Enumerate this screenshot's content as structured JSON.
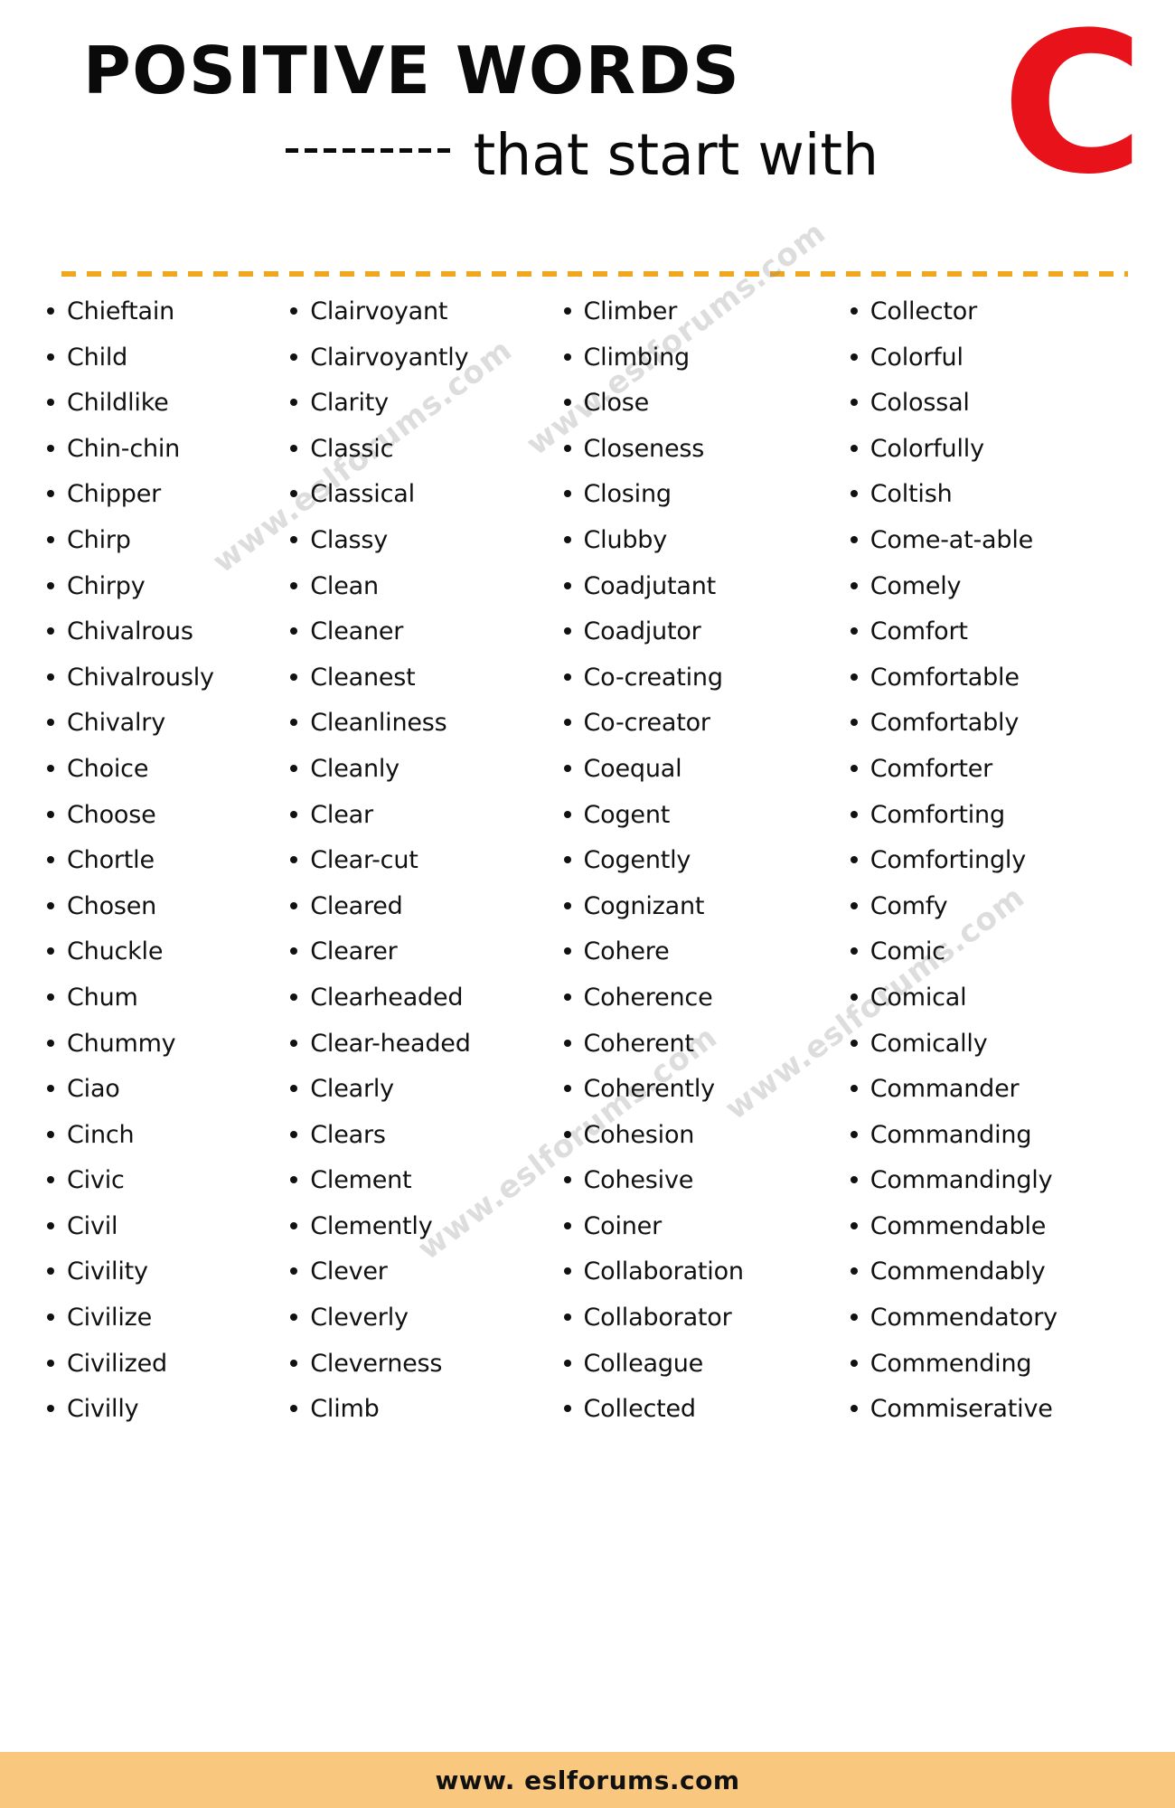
{
  "header": {
    "title_main": "POSITIVE WORDS",
    "title_sub": "that start with",
    "big_letter": "C",
    "accent_color": "#e8121a",
    "divider_color": "#efa620"
  },
  "watermark": {
    "text": "www.eslforums.com"
  },
  "footer": {
    "site": "www. eslforums.com",
    "background_color": "#f9c87e"
  },
  "columns": [
    {
      "id": "column-1",
      "words": [
        "Chieftain",
        "Child",
        "Childlike",
        "Chin-chin",
        "Chipper",
        "Chirp",
        "Chirpy",
        "Chivalrous",
        "Chivalrously",
        "Chivalry",
        "Choice",
        "Choose",
        "Chortle",
        "Chosen",
        "Chuckle",
        "Chum",
        "Chummy",
        "Ciao",
        "Cinch",
        "Civic",
        "Civil",
        "Civility",
        "Civilize",
        "Civilized",
        "Civilly"
      ]
    },
    {
      "id": "column-2",
      "words": [
        "Clairvoyant",
        "Clairvoyantly",
        "Clarity",
        "Classic",
        "Classical",
        "Classy",
        "Clean",
        "Cleaner",
        "Cleanest",
        "Cleanliness",
        "Cleanly",
        "Clear",
        "Clear-cut",
        "Cleared",
        "Clearer",
        "Clearheaded",
        "Clear-headed",
        "Clearly",
        "Clears",
        "Clement",
        "Clemently",
        "Clever",
        "Cleverly",
        "Cleverness",
        "Climb"
      ]
    },
    {
      "id": "column-3",
      "words": [
        "Climber",
        "Climbing",
        "Close",
        "Closeness",
        "Closing",
        "Clubby",
        "Coadjutant",
        "Coadjutor",
        "Co-creating",
        "Co-creator",
        "Coequal",
        "Cogent",
        "Cogently",
        "Cognizant",
        "Cohere",
        "Coherence",
        "Coherent",
        "Coherently",
        "Cohesion",
        "Cohesive",
        "Coiner",
        "Collaboration",
        "Collaborator",
        "Colleague",
        "Collected"
      ]
    },
    {
      "id": "column-4",
      "words": [
        "Collector",
        "Colorful",
        "Colossal",
        "Colorfully",
        "Coltish",
        "Come-at-able",
        "Comely",
        "Comfort",
        "Comfortable",
        "Comfortably",
        "Comforter",
        "Comforting",
        "Comfortingly",
        "Comfy",
        "Comic",
        "Comical",
        "Comically",
        "Commander",
        "Commanding",
        "Commandingly",
        "Commendable",
        "Commendably",
        "Commendatory",
        "Commending",
        "Commiserative"
      ]
    }
  ]
}
